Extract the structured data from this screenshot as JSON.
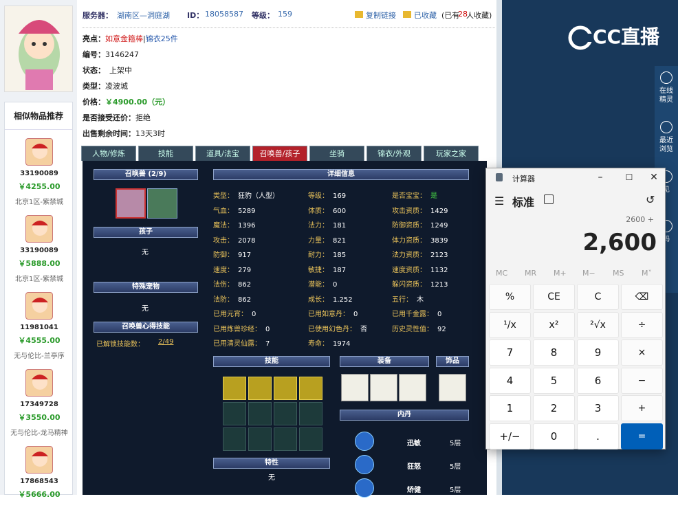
{
  "header": {
    "server_label": "服务器：",
    "server": "湖南区—洞庭湖",
    "id_label": "ID：",
    "id": "18058587",
    "level_label": "等级：",
    "level": "159",
    "copy": "复制链接",
    "fav": "已收藏",
    "fav_prefix": "(已有",
    "fav_count": "28",
    "fav_suffix": "人收藏)"
  },
  "info": {
    "highlight_label": "亮点：",
    "highlight1": "如意金箍棒",
    "sep": "|",
    "highlight2": "锦衣25件",
    "number_label": "编号：",
    "number": "3146247",
    "status_label": "状态：",
    "status": "上架中",
    "type_label": "类型：",
    "type": "凌波城",
    "price_label": "价格：",
    "price": "￥4900.00（元）",
    "bargain_label": "是否接受还价：",
    "bargain": "拒绝",
    "remain_label": "出售剩余时间：",
    "remain": "13天3时"
  },
  "recommend": {
    "title": "相似物品推荐",
    "items": [
      {
        "id": "33190089",
        "price": "￥4255.00",
        "server": "北京1区-紫禁城"
      },
      {
        "id": "33190089",
        "price": "￥5888.00",
        "server": "北京1区-紫禁城"
      },
      {
        "id": "11981041",
        "price": "￥4555.00",
        "server": "无与伦比-兰亭序"
      },
      {
        "id": "17349728",
        "price": "￥3550.00",
        "server": "无与伦比-龙马精神"
      },
      {
        "id": "17868543",
        "price": "￥5666.00",
        "server": ""
      }
    ]
  },
  "tabs": [
    "人物/修炼",
    "技能",
    "道具/法宝",
    "召唤兽/孩子",
    "坐骑",
    "锦衣/外观",
    "玩家之家"
  ],
  "panel": {
    "pet_title": "召唤兽 (2/9)",
    "child_title": "孩子",
    "child_value": "无",
    "special_title": "特殊宠物",
    "special_value": "无",
    "skill_title": "召唤兽心得技能",
    "unlocked_label": "已解锁技能数：",
    "unlocked": "2/49",
    "detail_title": "详细信息",
    "skills_title": "技能",
    "equip_title": "装备",
    "deco_title": "饰品",
    "neidan_title": "内丹",
    "trait_title": "特性",
    "trait_value": "无",
    "stats": [
      [
        "类型：",
        "狂豹（人型）"
      ],
      [
        "等级：",
        "169"
      ],
      [
        "是否宝宝：",
        "是"
      ],
      [
        "气血：",
        "5289"
      ],
      [
        "体质：",
        "600"
      ],
      [
        "攻击资质：",
        "1429"
      ],
      [
        "魔法：",
        "1396"
      ],
      [
        "法力：",
        "181"
      ],
      [
        "防御资质：",
        "1249"
      ],
      [
        "攻击：",
        "2078"
      ],
      [
        "力量：",
        "821"
      ],
      [
        "体力资质：",
        "3839"
      ],
      [
        "防御：",
        "917"
      ],
      [
        "耐力：",
        "185"
      ],
      [
        "法力资质：",
        "2123"
      ],
      [
        "速度：",
        "279"
      ],
      [
        "敏捷：",
        "187"
      ],
      [
        "速度资质：",
        "1132"
      ],
      [
        "法伤：",
        "862"
      ],
      [
        "潜能：",
        "0"
      ],
      [
        "躲闪资质：",
        "1213"
      ],
      [
        "法防：",
        "862"
      ],
      [
        "成长：",
        "1.252"
      ],
      [
        "五行：",
        "木"
      ],
      [
        "已用元宵：",
        "0"
      ],
      [
        "已用如意丹：",
        "0"
      ],
      [
        "已用千金露：",
        "0"
      ],
      [
        "已用炼兽珍经：",
        "0"
      ],
      [
        "已使用幻色丹：",
        "否"
      ],
      [
        "历史灵性值：",
        "92"
      ],
      [
        "已用清灵仙露：",
        "7"
      ],
      [
        "寿命：",
        "1974"
      ]
    ],
    "neidan": [
      [
        "迅敏",
        "5层"
      ],
      [
        "狂怒",
        "5层"
      ],
      [
        "矫健",
        "5层"
      ]
    ]
  },
  "right": {
    "logo": "CC直播",
    "side": [
      "在线精灵",
      "最近浏览",
      "见",
      "码"
    ]
  },
  "calc": {
    "title": "计算器",
    "mode": "标准",
    "expr": "2600 +",
    "display": "2,600",
    "mem": [
      "MC",
      "MR",
      "M+",
      "M−",
      "MS",
      "M˅"
    ],
    "keys": [
      "%",
      "CE",
      "C",
      "⌫",
      "¹/x",
      "x²",
      "²√x",
      "÷",
      "7",
      "8",
      "9",
      "×",
      "4",
      "5",
      "6",
      "−",
      "1",
      "2",
      "3",
      "+",
      "+/−",
      "0",
      ".",
      "="
    ]
  },
  "colors": {
    "accent": "#b3212a",
    "price": "#2a9a2a",
    "calc_eq": "#005fb8"
  }
}
